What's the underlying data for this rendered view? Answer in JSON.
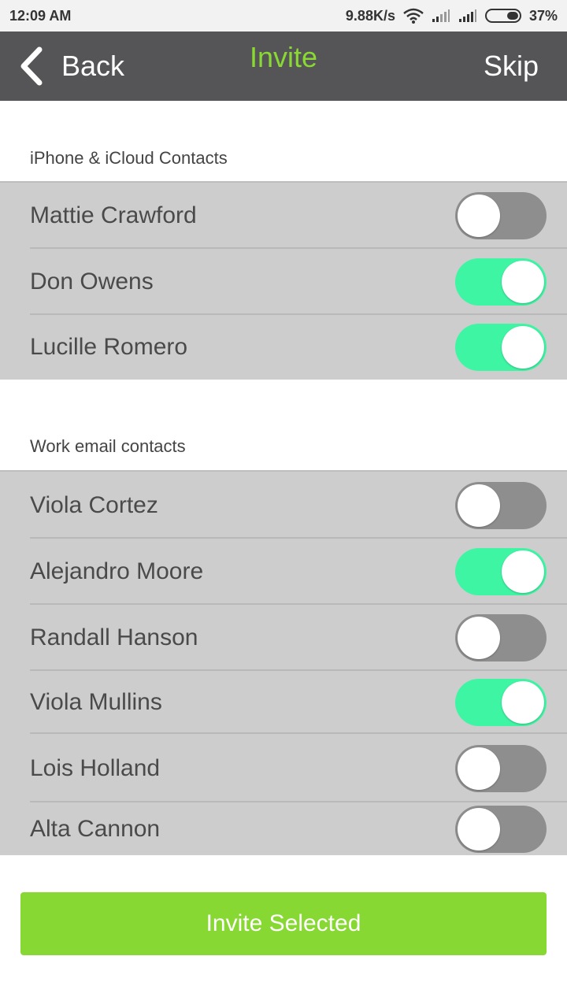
{
  "status_bar": {
    "time": "12:09 AM",
    "network_speed": "9.88K/s",
    "battery": "37%",
    "icons": [
      "wifi-icon",
      "signal-icon",
      "signal-icon",
      "battery-icon"
    ]
  },
  "nav": {
    "back_label": "Back",
    "title": "Invite",
    "skip_label": "Skip",
    "title_color": "#8ad833",
    "background": "#555558"
  },
  "sections": [
    {
      "header": "iPhone & iCloud Contacts",
      "contacts": [
        {
          "name": "Mattie Crawford",
          "selected": false
        },
        {
          "name": "Don Owens",
          "selected": true
        },
        {
          "name": "Lucille Romero",
          "selected": true
        }
      ]
    },
    {
      "header": "Work email contacts",
      "contacts": [
        {
          "name": "Viola Cortez",
          "selected": false
        },
        {
          "name": "Alejandro Moore",
          "selected": true
        },
        {
          "name": "Randall Hanson",
          "selected": false
        },
        {
          "name": "Viola Mullins",
          "selected": true
        },
        {
          "name": "Lois Holland",
          "selected": false
        },
        {
          "name": "Alta Cannon",
          "selected": false
        }
      ]
    }
  ],
  "colors": {
    "toggle_on": "#3ef5a3",
    "toggle_off": "#8e8e8e",
    "accent": "#87d833",
    "row_background": "#cdcdcd"
  },
  "invite_button_label": "Invite Selected"
}
